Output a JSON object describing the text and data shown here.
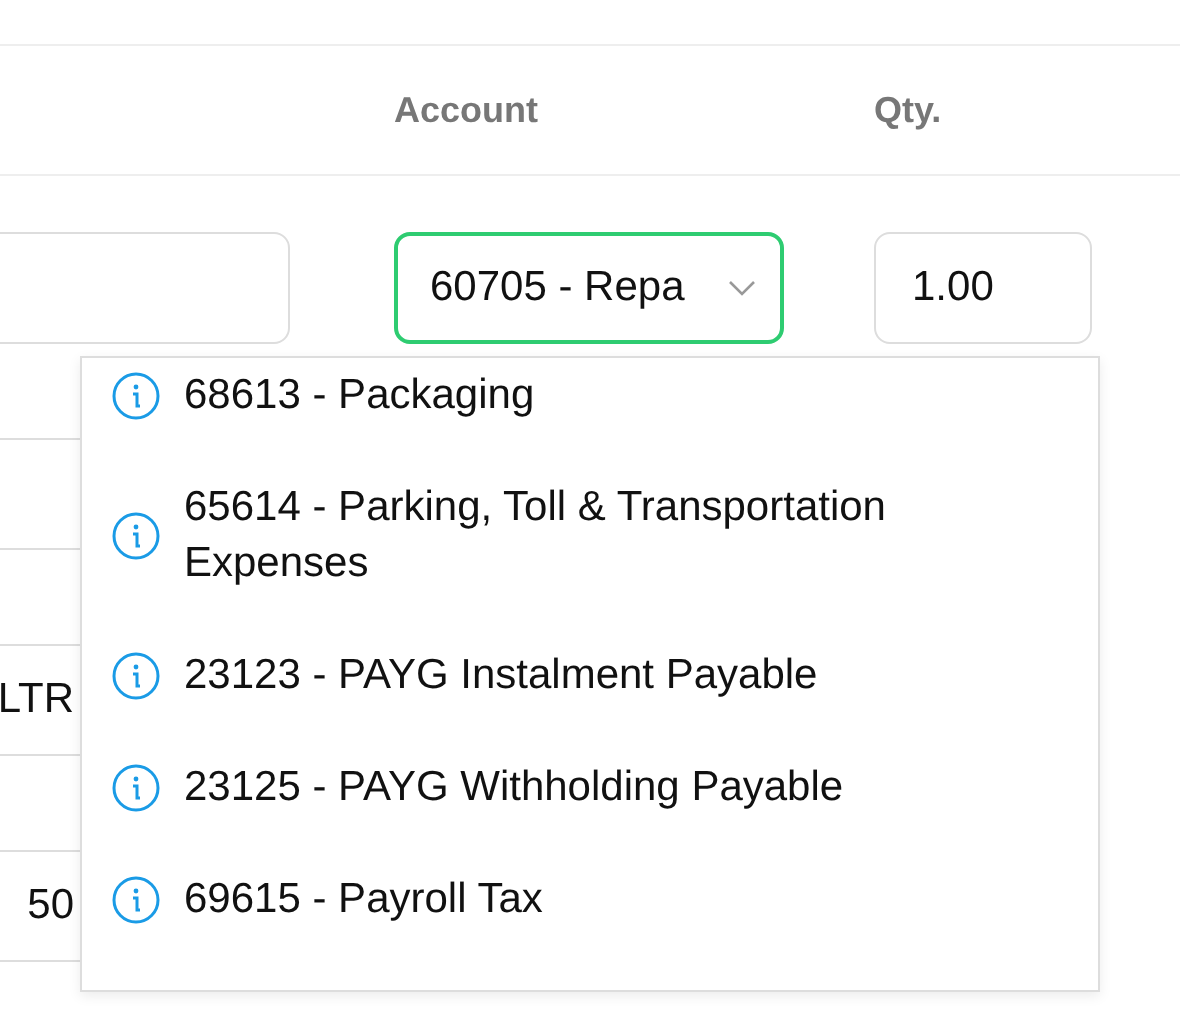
{
  "columns": [
    "Account",
    "Qty."
  ],
  "line": {
    "account": "60705 - Repa",
    "qty": "1.00"
  },
  "left_cells": [
    {},
    {
      "value": "LTR"
    },
    {
      "value": "50"
    }
  ],
  "dropdown": {
    "options": [
      {
        "label": "68613 - Packaging"
      },
      {
        "label": "65614 - Parking, Toll & Transportation Expenses"
      },
      {
        "label": "23123 - PAYG Instalment Payable"
      },
      {
        "label": "23125 - PAYG Withholding Payable"
      },
      {
        "label": "69615 - Payroll Tax"
      }
    ]
  }
}
